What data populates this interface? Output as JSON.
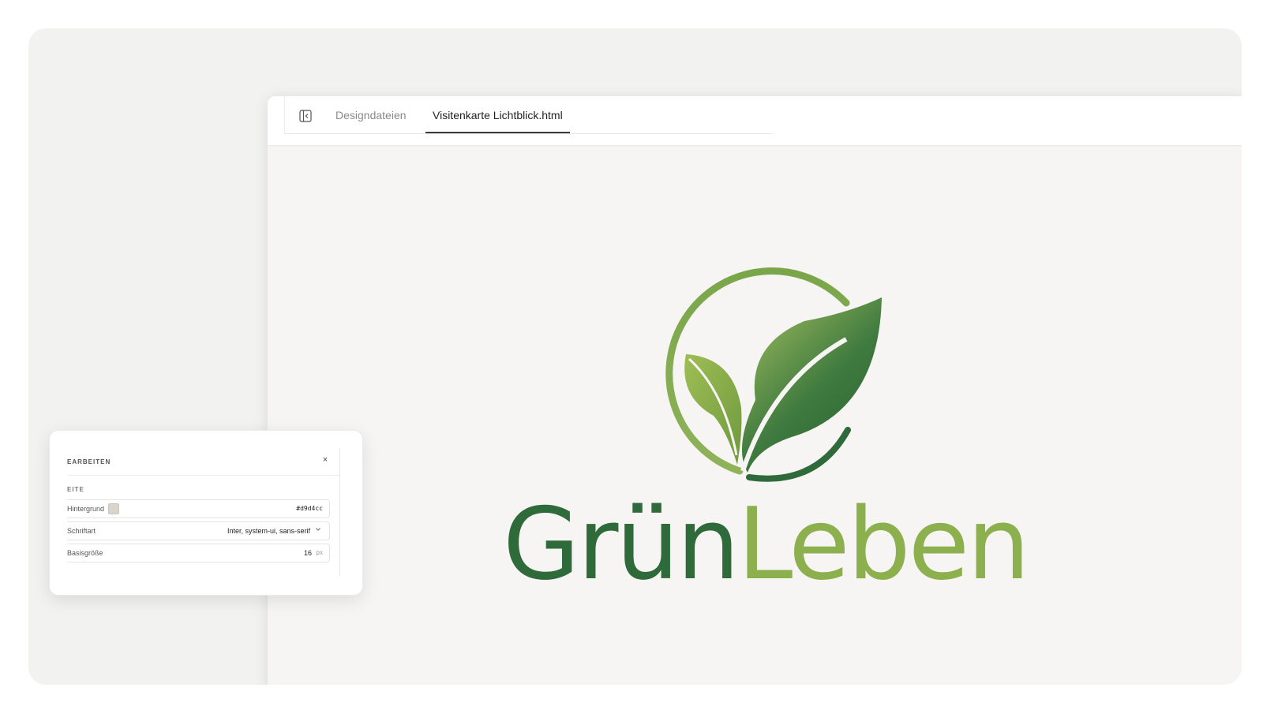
{
  "tabs": [
    {
      "label": "Designdateien",
      "active": false
    },
    {
      "label": "Visitenkarte Lichtblick.html",
      "active": true
    }
  ],
  "icons": {
    "sidebar_toggle": "sidebar-panel-icon",
    "logo": "leaf-circle-logo",
    "close": "close-icon",
    "chevron": "chevron-down-icon"
  },
  "canvas": {
    "wordmark_part1": "Grün",
    "wordmark_part2": "Leben",
    "colors": {
      "dark_green": "#2f6b3a",
      "light_green": "#8db04e",
      "background": "#f6f5f3"
    }
  },
  "edit_panel": {
    "title": "EARBEITEN",
    "close_label": "×",
    "section_label": "EITE",
    "properties": [
      {
        "label": "Hintergrund",
        "value": "#d9d4cc",
        "swatch_color": "#d9d4cc"
      },
      {
        "label": "Schriftart",
        "value": "Inter, system-ui, sans-serif"
      },
      {
        "label": "Basisgröße",
        "value": "16",
        "unit": "px"
      }
    ]
  }
}
